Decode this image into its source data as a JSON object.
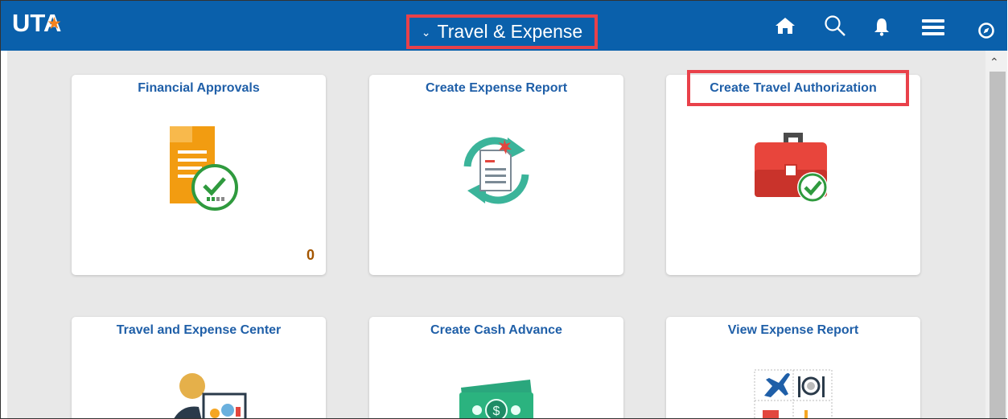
{
  "header": {
    "logo_text": "UTA",
    "title": "Travel & Expense",
    "bar_color": "#0a60ab",
    "icons": [
      "home-icon",
      "search-icon",
      "notification-bell-icon",
      "menu-icon",
      "navbar-compass-icon"
    ]
  },
  "tiles": [
    {
      "title": "Financial Approvals",
      "count": "0",
      "icon": "approval-document-icon"
    },
    {
      "title": "Create Expense Report",
      "icon": "expense-report-refresh-icon"
    },
    {
      "title": "Create Travel Authorization",
      "icon": "briefcase-check-icon"
    },
    {
      "title": "Travel and Expense Center",
      "icon": "expense-center-icon"
    },
    {
      "title": "Create Cash Advance",
      "icon": "cash-icon"
    },
    {
      "title": "View Expense Report",
      "icon": "expense-categories-icon"
    }
  ],
  "colors": {
    "tile_title": "#1f5fa8",
    "count": "#a35500",
    "highlight": "#e9414a"
  }
}
